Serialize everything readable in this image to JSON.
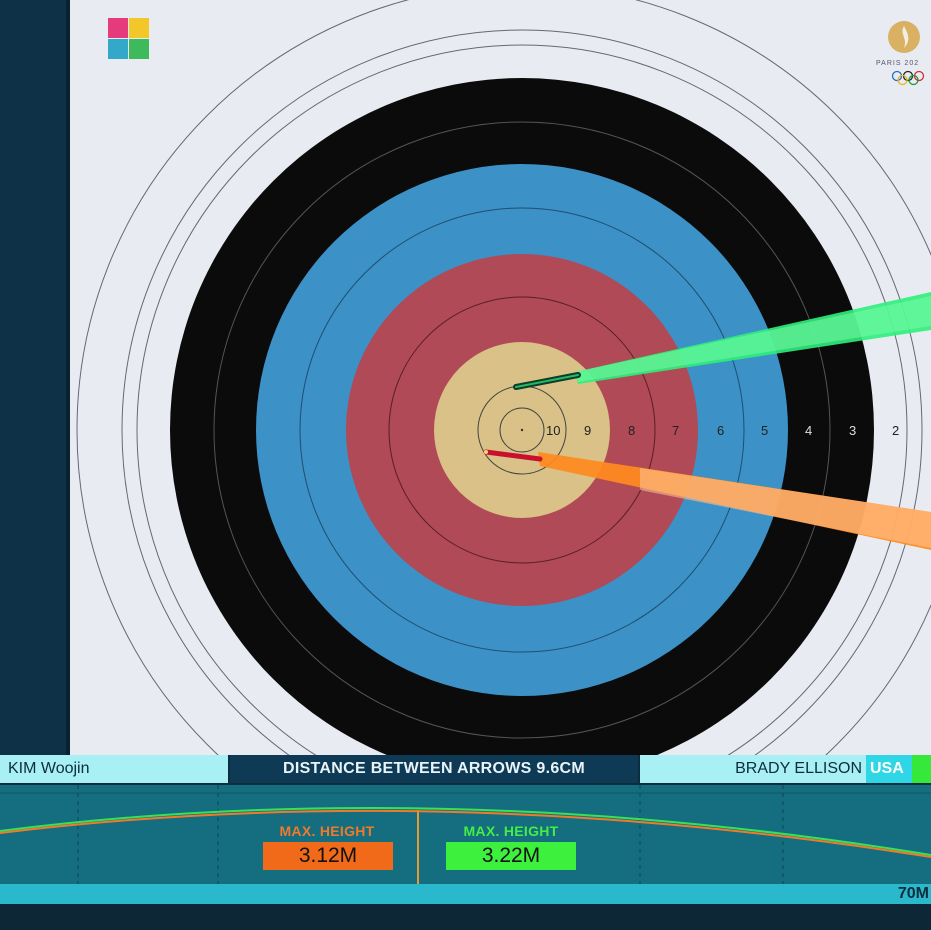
{
  "target": {
    "ring_numbers": [
      "10",
      "9",
      "8",
      "7",
      "6",
      "5",
      "4",
      "3",
      "2"
    ],
    "colors": {
      "gold": "#d9c187",
      "red": "#b04a56",
      "blue": "#3c91c7",
      "black": "#0b0b0b",
      "white": "#e8ecf2"
    }
  },
  "logos": {
    "left": "world-archery-logo",
    "right": "paris-2024-logo",
    "right_text": "PARIS 202"
  },
  "info_bar": {
    "left_athlete": "KIM Woojin",
    "headline": "DISTANCE BETWEEN ARROWS 9.6CM",
    "right_athlete": "BRADY ELLISON",
    "right_country": "USA"
  },
  "trajectory": {
    "left_max_height_label": "MAX. HEIGHT",
    "left_max_height_value": "3.12M",
    "right_max_height_label": "MAX. HEIGHT",
    "right_max_height_value": "3.22M",
    "distance_label": "70M"
  },
  "arrows": [
    {
      "name": "green-arrow",
      "color": "#2ef07a"
    },
    {
      "name": "orange-arrow",
      "color": "#ff8a1e"
    }
  ]
}
